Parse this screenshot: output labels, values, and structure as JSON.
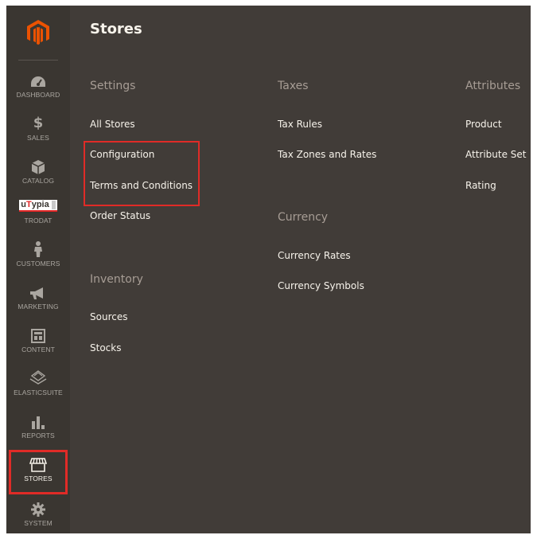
{
  "sidebar": {
    "items": [
      {
        "key": "dashboard",
        "label": "DASHBOARD",
        "icon": "dashboard-icon"
      },
      {
        "key": "sales",
        "label": "SALES",
        "icon": "dollar-icon"
      },
      {
        "key": "catalog",
        "label": "CATALOG",
        "icon": "box-icon"
      },
      {
        "key": "trodat",
        "label": "TRODAT",
        "icon": "utypia-logo",
        "logo_text": "uTypia"
      },
      {
        "key": "customers",
        "label": "CUSTOMERS",
        "icon": "person-icon"
      },
      {
        "key": "marketing",
        "label": "MARKETING",
        "icon": "megaphone-icon"
      },
      {
        "key": "content",
        "label": "CONTENT",
        "icon": "layout-icon"
      },
      {
        "key": "elasticsuite",
        "label": "ELASTICSUITE",
        "icon": "elasticsuite-icon"
      },
      {
        "key": "reports",
        "label": "REPORTS",
        "icon": "bar-chart-icon"
      },
      {
        "key": "stores",
        "label": "STORES",
        "icon": "storefront-icon",
        "active": true
      },
      {
        "key": "system",
        "label": "SYSTEM",
        "icon": "gear-icon"
      }
    ]
  },
  "panel": {
    "title": "Stores",
    "settings": {
      "title": "Settings",
      "links": [
        "All Stores",
        "Configuration",
        "Terms and Conditions",
        "Order Status"
      ]
    },
    "inventory": {
      "title": "Inventory",
      "links": [
        "Sources",
        "Stocks"
      ]
    },
    "taxes": {
      "title": "Taxes",
      "links": [
        "Tax Rules",
        "Tax Zones and Rates"
      ]
    },
    "currency": {
      "title": "Currency",
      "links": [
        "Currency Rates",
        "Currency Symbols"
      ]
    },
    "attributes": {
      "title": "Attributes",
      "links": [
        "Product",
        "Attribute Set",
        "Rating"
      ]
    }
  },
  "colors": {
    "accent_orange": "#eb5202",
    "highlight_red": "#e02b27",
    "panel_bg": "#413c38",
    "sidebar_bg": "#3a3631"
  }
}
